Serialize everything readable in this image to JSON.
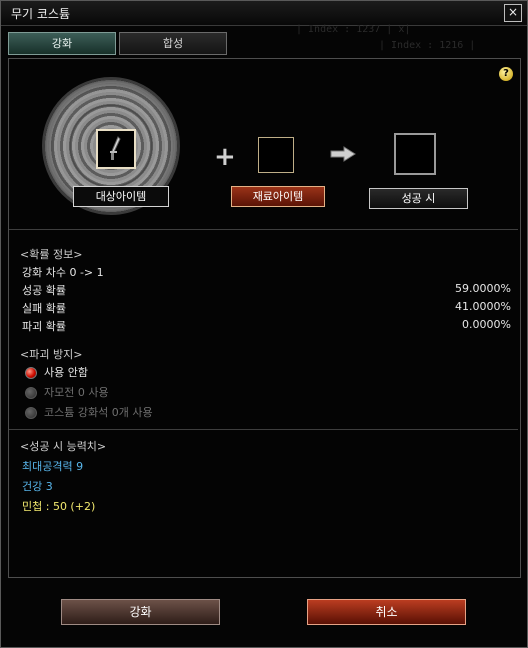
{
  "window": {
    "title": "무기 코스튬"
  },
  "debug": {
    "line1": "| Index : 1237 | x|",
    "line2": "| Index : 1216 |"
  },
  "tabs": [
    {
      "label": "강화"
    },
    {
      "label": "합성"
    }
  ],
  "slots": {
    "target_label": "대상아이템",
    "material_label": "재료아이템",
    "result_label": "성공 시"
  },
  "probability": {
    "header": "<확률 정보>",
    "stage": "강화 차수 0 -> 1",
    "rows": [
      {
        "label": "성공 확률",
        "value": "59.0000%"
      },
      {
        "label": "실패 확률",
        "value": "41.0000%"
      },
      {
        "label": "파괴 확률",
        "value": "0.0000%"
      }
    ]
  },
  "protection": {
    "header": "<파괴 방지>",
    "options": [
      {
        "label": "사용 안함",
        "selected": true
      },
      {
        "label": "자모전 0 사용",
        "selected": false
      },
      {
        "label": "코스튬 강화석 0개 사용",
        "selected": false
      }
    ]
  },
  "stats": {
    "header": "<성공 시 능력치>",
    "lines": [
      {
        "text": "최대공격력 9",
        "color": "#58b5ea"
      },
      {
        "text": "건강 3",
        "color": "#58b5ea"
      },
      {
        "text": "민첩 : 50 (+2)",
        "color": "#f2e96f"
      }
    ]
  },
  "buttons": {
    "enhance": "강화",
    "cancel": "취소"
  },
  "icons": {
    "help": "help-icon",
    "close": "close-icon",
    "plus": "plus-icon",
    "arrow": "arrow-right-icon",
    "item": "sword-icon"
  }
}
